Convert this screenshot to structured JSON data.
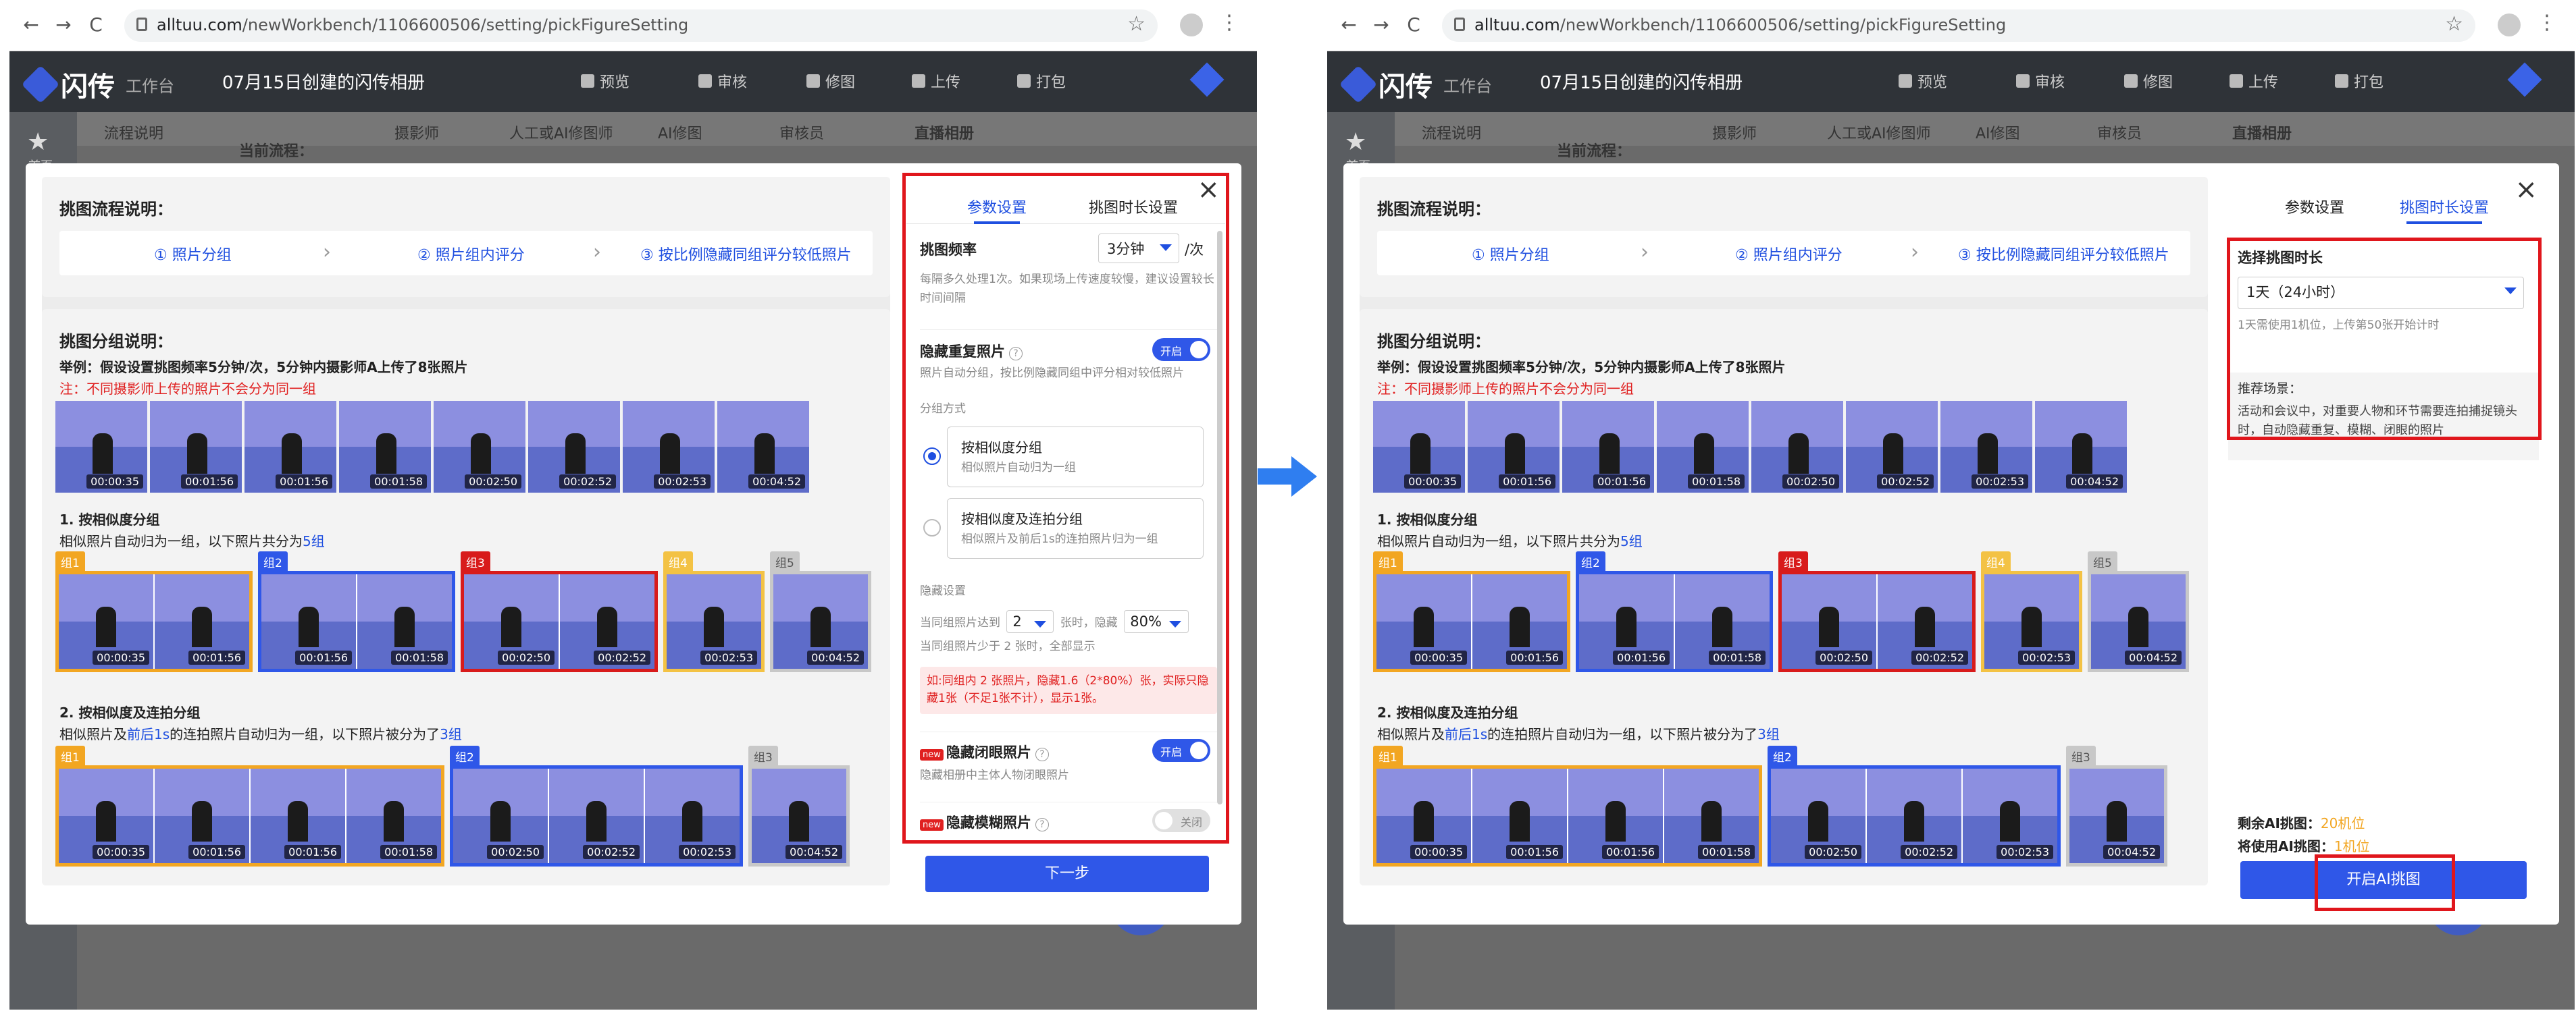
{
  "browser": {
    "url_host": "alltuu.com",
    "url_path": "/newWorkbench/1106600506/setting/pickFigureSetting",
    "back": "←",
    "forward": "→",
    "reload": "C",
    "star": "☆",
    "menu": "⋮"
  },
  "app": {
    "logo": "闪传",
    "logo_sub": "工作台",
    "album_title": "07月15日创建的闪传相册",
    "top_menu": [
      "预览",
      "审核",
      "修图",
      "上传",
      "打包"
    ],
    "sidebar_home": "首页",
    "sub_tabs": [
      "流程说明",
      "摄影师",
      "人工或AI修图师",
      "AI修图",
      "审核员",
      "直播相册"
    ],
    "current_flow": "当前流程："
  },
  "modal": {
    "flow_title": "挑图流程说明：",
    "steps": [
      "① 照片分组",
      "② 照片组内评分",
      "③ 按比例隐藏同组评分较低照片"
    ],
    "group_title": "挑图分组说明：",
    "example": "举例：假设设置挑图频率5分钟/次，5分钟内摄影师A上传了8张照片",
    "note": "注：不同摄影师上传的照片不会分为同一组",
    "timestamps": [
      "00:00:35",
      "00:01:56",
      "00:01:56",
      "00:01:58",
      "00:02:50",
      "00:02:52",
      "00:02:53",
      "00:04:52"
    ],
    "method1_title": "1. 按相似度分组",
    "method1_desc_pre": "相似照片自动归为一组，以下照片共分为",
    "method1_count": "5组",
    "method1_groups": [
      "组1",
      "组2",
      "组3",
      "组4",
      "组5"
    ],
    "method2_title": "2. 按相似度及连拍分组",
    "method2_desc_pre": "相似照片及",
    "method2_desc_mid": "前后1s",
    "method2_desc_post": "的连拍照片自动归为一组，以下照片被分为了",
    "method2_count": "3组",
    "method2_groups": [
      "组1",
      "组2",
      "组3"
    ],
    "close": "×"
  },
  "settings_left": {
    "tab_params": "参数设置",
    "tab_duration": "挑图时长设置",
    "freq_label": "挑图频率",
    "freq_value": "3分钟",
    "freq_unit": "/次",
    "freq_hint": "每隔多久处理1次。如果现场上传速度较慢，建议设置较长时间间隔",
    "hide_dup_label": "隐藏重复照片",
    "hide_dup_hint": "照片自动分组，按比例隐藏同组中评分相对较低照片",
    "toggle_on": "开启",
    "toggle_off": "关闭",
    "group_method": "分组方式",
    "opt1_title": "按相似度分组",
    "opt1_desc": "相似照片自动归为一组",
    "opt2_title": "按相似度及连拍分组",
    "opt2_desc": "相似照片及前后1s的连拍照片归为一组",
    "hide_settings": "隐藏设置",
    "hide_rule_pre": "当同组照片达到",
    "hide_rule_count": "2",
    "hide_rule_mid": "张时，隐藏",
    "hide_rule_pct": "80%",
    "hide_rule_min": "当同组照片少于 2 张时，全部显示",
    "warning": "如:同组内 2 张照片，隐藏1.6（2*80%）张，实际只隐藏1张（不足1张不计），显示1张。",
    "new_badge": "new",
    "closed_eyes_label": "隐藏闭眼照片",
    "closed_eyes_hint": "隐藏相册中主体人物闭眼照片",
    "blurry_label": "隐藏模糊照片",
    "next": "下一步"
  },
  "settings_right": {
    "duration_label": "选择挑图时长",
    "duration_value": "1天（24小时）",
    "duration_hint": "1天需使用1机位，上传第50张开始计时",
    "scene_label": "推荐场景：",
    "scene_desc": "活动和会议中，对重要人物和环节需要连拍捕捉镜头时，自动隐藏重复、模糊、闭眼的照片",
    "remaining_label": "剩余AI挑图：",
    "remaining_value": "20机位",
    "use_label": "将使用AI挑图：",
    "use_value": "1机位",
    "start_button": "开启AI挑图"
  },
  "colors": {
    "accent": "#2f57e8",
    "highlight": "#e0161c",
    "orange": "#f2a622"
  }
}
